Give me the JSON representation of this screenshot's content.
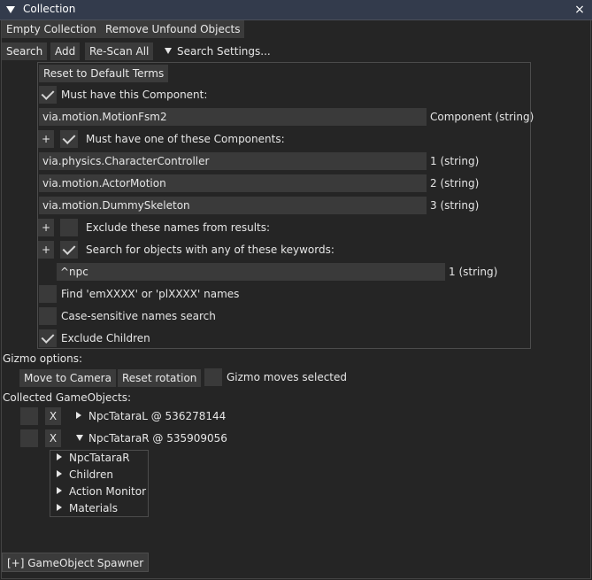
{
  "window": {
    "title": "Collection",
    "close_icon": "×"
  },
  "toolbar1": {
    "empty": "Empty Collection",
    "remove": "Remove Unfound Objects"
  },
  "toolbar2": {
    "search": "Search",
    "add": "Add",
    "rescan": "Re-Scan All",
    "settings": "Search Settings..."
  },
  "settings": {
    "reset": "Reset to Default Terms",
    "must_have": {
      "label": "Must have this Component:",
      "checked": true,
      "value": "via.motion.MotionFsm2",
      "type": "Component (string)"
    },
    "one_of": {
      "plus": "+",
      "label": "Must have one of these Components:",
      "checked": true,
      "items": [
        {
          "value": "via.physics.CharacterController",
          "type": "1 (string)"
        },
        {
          "value": "via.motion.ActorMotion",
          "type": "2 (string)"
        },
        {
          "value": "via.motion.DummySkeleton",
          "type": "3 (string)"
        }
      ]
    },
    "exclude": {
      "plus": "+",
      "label": "Exclude these names from results:",
      "checked": false
    },
    "keywords": {
      "plus": "+",
      "label": "Search for objects with any of these keywords:",
      "checked": true,
      "value": "^npc",
      "type": "1 (string)"
    },
    "find_em": {
      "label": "Find 'emXXXX' or 'plXXXX' names",
      "checked": false
    },
    "case": {
      "label": "Case-sensitive names search",
      "checked": false
    },
    "exclude_children": {
      "label": "Exclude Children",
      "checked": true
    }
  },
  "gizmo": {
    "title": "Gizmo options:",
    "move": "Move to Camera",
    "reset": "Reset rotation",
    "moves_selected": "Gizmo moves selected"
  },
  "collected": {
    "title": "Collected GameObjects:",
    "objects": [
      {
        "x": "X",
        "name": "NpcTataraL @ 536278144",
        "expanded": false
      },
      {
        "x": "X",
        "name": "NpcTataraR @ 535909056",
        "expanded": true
      }
    ],
    "children": [
      "NpcTataraR",
      "Children",
      "Action Monitor",
      "Materials"
    ]
  },
  "spawner": "[+] GameObject Spawner",
  "colors": {
    "titlebar": "#333b4c",
    "background": "#252525",
    "button": "#3b3b3b",
    "checkbox": "#3a3a3a"
  }
}
